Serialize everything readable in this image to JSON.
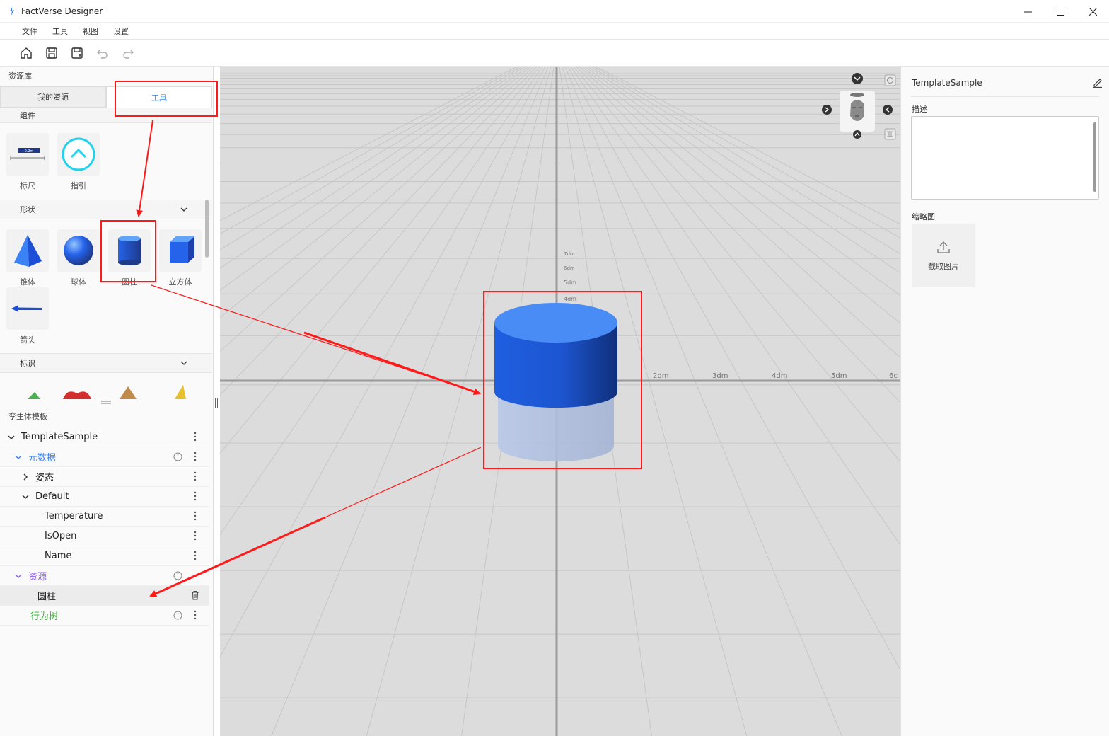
{
  "window": {
    "title": "FactVerse Designer"
  },
  "menu": [
    "文件",
    "工具",
    "视图",
    "设置"
  ],
  "left": {
    "header": "资源库",
    "tabs": [
      "我的资源",
      "工具"
    ],
    "sections": {
      "components": {
        "title": "组件",
        "items": [
          "标尺",
          "指引"
        ],
        "ruler_text": "0.2m"
      },
      "shapes": {
        "title": "形状",
        "items": [
          "锥体",
          "球体",
          "圆柱",
          "立方体",
          "箭头"
        ]
      },
      "markers": {
        "title": "标识"
      }
    },
    "tree": {
      "header": "孪生体模板",
      "rows": [
        {
          "label": "TemplateSample"
        },
        {
          "label": "元数据"
        },
        {
          "label": "姿态"
        },
        {
          "label": "Default"
        },
        {
          "label": "Temperature"
        },
        {
          "label": "IsOpen"
        },
        {
          "label": "Name"
        },
        {
          "label": "资源"
        },
        {
          "label": "圆柱"
        },
        {
          "label": "行为树"
        }
      ]
    }
  },
  "viewport": {
    "axis_x_labels": [
      "2dm",
      "3dm",
      "4dm",
      "5dm",
      "6c"
    ],
    "axis_y_labels": [
      "7dm",
      "6dm",
      "5dm",
      "4dm"
    ]
  },
  "right": {
    "title": "TemplateSample",
    "desc_label": "描述",
    "thumb_label": "缩略图",
    "capture_label": "截取图片"
  },
  "colors": {
    "accent_blue": "#4a90e2",
    "annotation_red": "#ff1a1a",
    "meta_blue": "#3b82f6",
    "resource_purple": "#8b5cf6",
    "behavior_green": "#35b335"
  }
}
